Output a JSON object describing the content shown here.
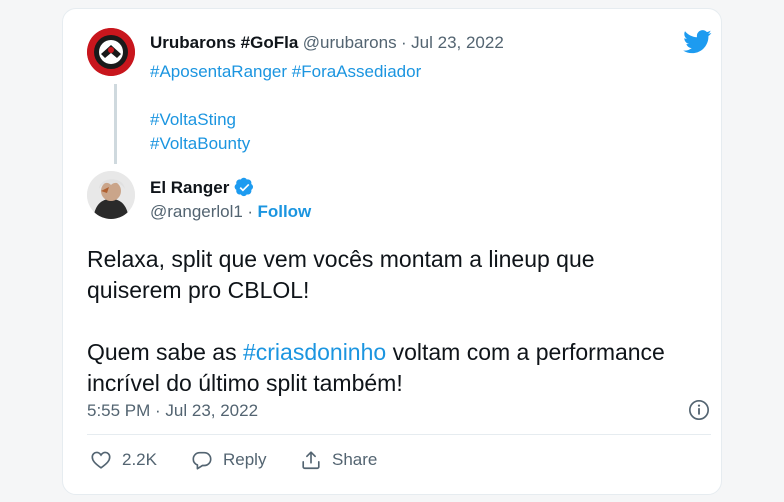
{
  "quoted_tweet": {
    "display_name": "Urubarons #GoFla",
    "handle": "@urubarons",
    "separator": "·",
    "date": "Jul 23, 2022",
    "hashtags_line1": "#AposentaRanger #ForaAssediador",
    "hashtag_line2": "#VoltaSting",
    "hashtag_line3": "#VoltaBounty"
  },
  "reply_tweet": {
    "display_name": "El Ranger",
    "handle": "@rangerlol1",
    "separator": "·",
    "follow_label": "Follow",
    "line1": "Relaxa, split que vem vocês montam a lineup que",
    "line2": "quiserem pro CBLOL!",
    "line3_prefix": "Quem sabe as ",
    "line3_tag": "#criasdoninho",
    "line3_suffix": " voltam com a performance",
    "line4": "incrível do último split também!",
    "timestamp": "5:55 PM · Jul 23, 2022"
  },
  "actions": {
    "like_count": "2.2K",
    "reply_label": "Reply",
    "share_label": "Share"
  },
  "icons": {
    "brand": "twitter-bird-icon",
    "verified": "verified-badge-icon",
    "info": "info-icon",
    "like": "heart-icon",
    "reply": "reply-bubble-icon",
    "share": "share-icon"
  },
  "colors": {
    "link_blue": "#1b95e0",
    "verified_blue": "#1d9bf0",
    "text": "#0f1419",
    "muted": "#536471"
  }
}
